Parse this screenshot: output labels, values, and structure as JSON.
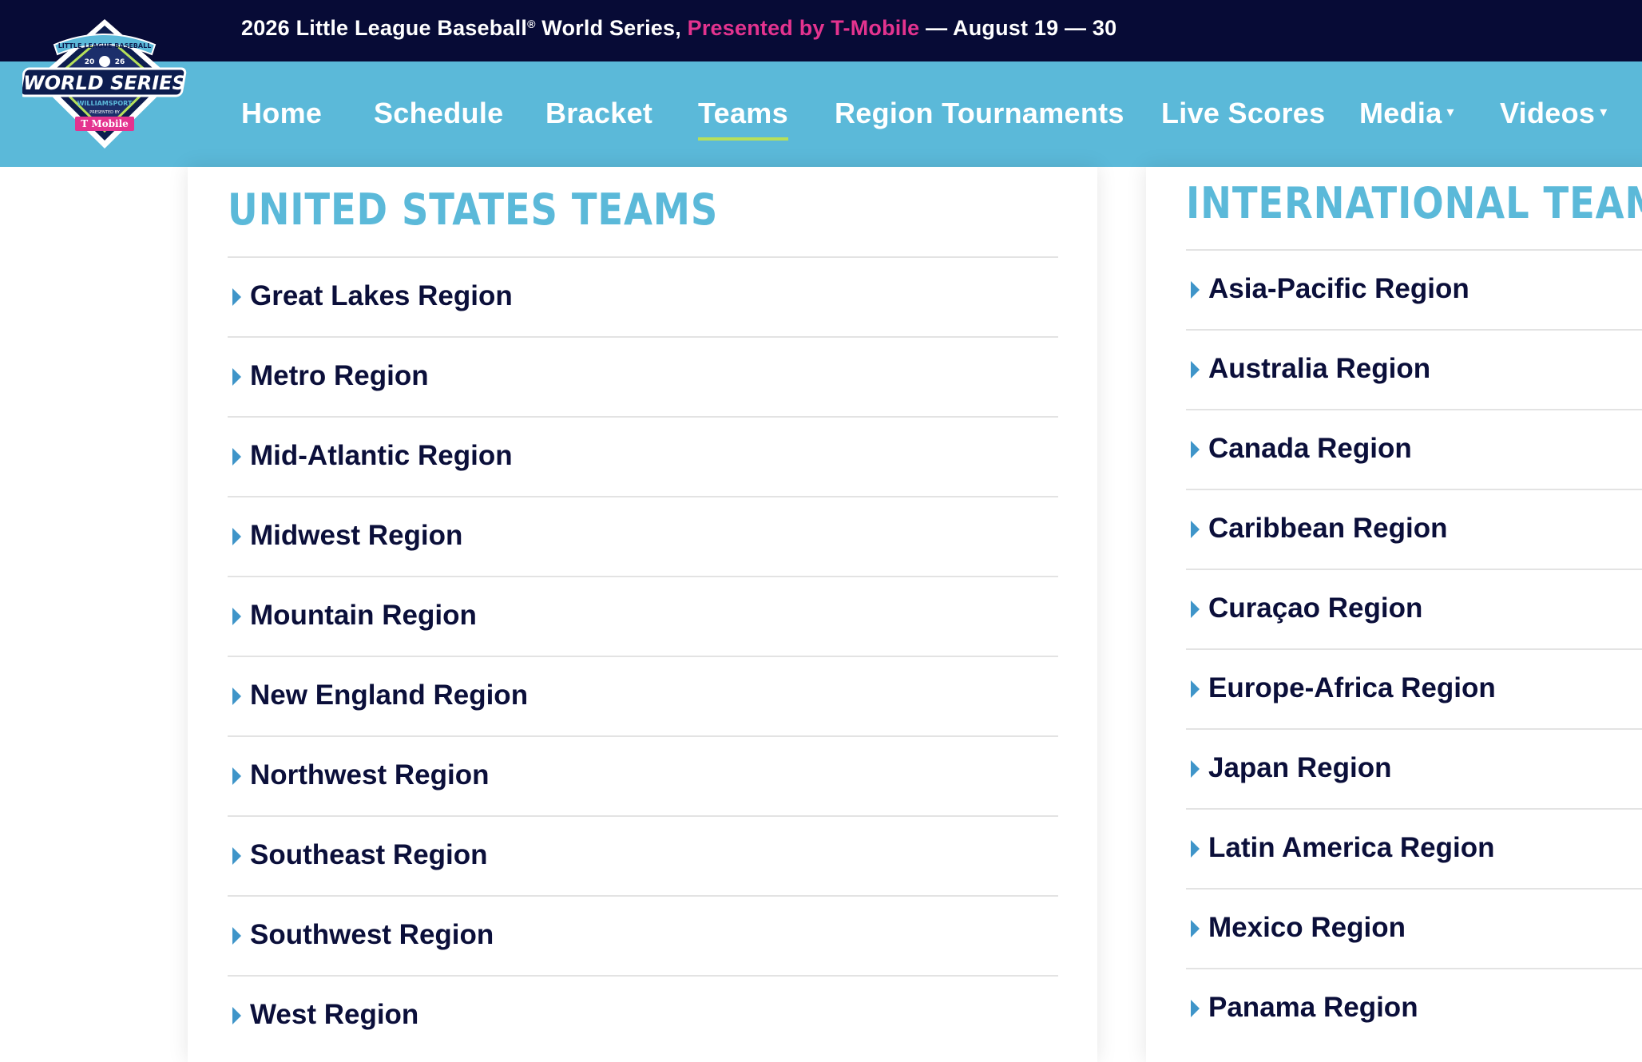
{
  "header": {
    "announcement": {
      "prefix": "2026 Little League Baseball",
      "registered": "®",
      "middle": " World Series, ",
      "presented": "Presented by T-Mobile",
      "suffix": " — August 19 — 30"
    },
    "logo": {
      "arc_text": "LITTLE LEAGUE BASEBALL",
      "year_left": "20",
      "year_right": "26",
      "title": "WORLD SERIES",
      "location": "WILLIAMSPORT",
      "presented_by": "PRESENTED BY",
      "sponsor": "T Mobile"
    }
  },
  "nav": {
    "items": [
      {
        "label": "Home"
      },
      {
        "label": "Schedule"
      },
      {
        "label": "Bracket"
      },
      {
        "label": "Teams",
        "active": true
      },
      {
        "label": "Region Tournaments"
      },
      {
        "label": "Live Scores"
      },
      {
        "label": "Media",
        "caret": "▾"
      },
      {
        "label": "Videos",
        "caret": "▾"
      }
    ]
  },
  "us_teams": {
    "title": "UNITED STATES TEAMS",
    "regions": [
      "Great Lakes Region",
      "Metro Region",
      "Mid-Atlantic Region",
      "Midwest Region",
      "Mountain Region",
      "New England Region",
      "Northwest Region",
      "Southeast Region",
      "Southwest Region",
      "West Region"
    ]
  },
  "intl_teams": {
    "title": "INTERNATIONAL TEAMS",
    "regions": [
      "Asia-Pacific Region",
      "Australia Region",
      "Canada Region",
      "Caribbean Region",
      "Curaçao Region",
      "Europe-Africa Region",
      "Japan Region",
      "Latin America Region",
      "Mexico Region",
      "Panama Region"
    ]
  },
  "colors": {
    "topbar_bg": "#070b36",
    "nav_bg": "#5bb9d9",
    "accent_pink": "#e4338f",
    "active_underline": "#b6e05a",
    "title_blue": "#5bb9d9",
    "text_navy": "#0b0f3a",
    "triangle_blue": "#3f95c9"
  },
  "icons": {
    "expand": "caret-right-icon",
    "dropdown": "chevron-down-icon"
  }
}
